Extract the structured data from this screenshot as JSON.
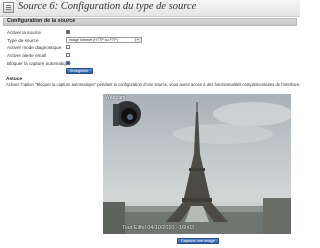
{
  "header": {
    "title": "Source 6: Configuration du type de source",
    "icon": "source-config-icon"
  },
  "section": {
    "title": "Configuration de la source"
  },
  "form": {
    "enable_label": "Activer la source",
    "enable_checked": true,
    "type_label": "Type de source",
    "type_value": "Image Internet (HTTP ou FTP)",
    "diagnostic_label": "Activer mode diagnostique",
    "diagnostic_checked": false,
    "email_label": "Activer alerte email",
    "email_checked": false,
    "autocapture_label": "Bloquer la capture automatique",
    "autocapture_checked": true,
    "save_label": "Enregistrer"
  },
  "note": {
    "title": "Astuce",
    "text": "Activez l'option \"Bloquer la capture automatique\" pendant la configuration d'une source, vous aurez accès à des fonctionnalités complémentaires de l'interface."
  },
  "preview": {
    "logo_text": "Webcam",
    "timestamp": "Tour Eiffel 04/10/2010 - 16h03",
    "capture_label": "Capturer une image"
  },
  "colors": {
    "accent": "#2f61a8",
    "checkbox_fill": "#2a5db0"
  }
}
